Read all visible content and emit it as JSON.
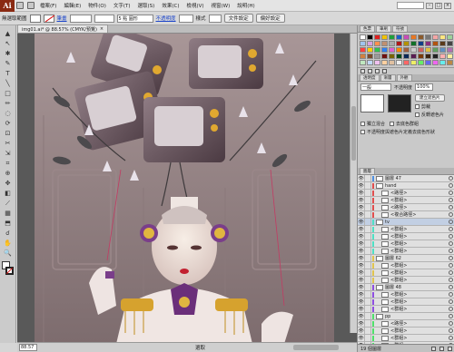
{
  "app": {
    "logo": "Ai",
    "workspace": "無違取範圍",
    "menus": [
      "檔案(F)",
      "編輯(E)",
      "物件(O)",
      "文字(T)",
      "選取(S)",
      "效果(C)",
      "檢視(V)",
      "視窗(W)",
      "說明(H)"
    ]
  },
  "controlbar": {
    "selection_label": "無選取範圍",
    "stroke_label": "筆畫",
    "stroke_weight": "",
    "brush_value": "5 點 圓形",
    "opacity_link": "不透明度",
    "style_label": "樣式",
    "doc_setup_button": "文件設定",
    "preferences_button": "偏好設定"
  },
  "tools": [
    "▲",
    "↖",
    "✱",
    "✎",
    "T",
    "╲",
    "□",
    "✏",
    "◌",
    "⟳",
    "⊡",
    "✂",
    "⇲",
    "⌗",
    "⊕",
    "✥",
    "◧",
    "⟋",
    "▦",
    "⬒",
    "☌",
    "✋",
    "🔍"
  ],
  "document": {
    "tab_title": "img01.ai* @ 88.57% (CMYK/預覽)",
    "tab_close": "×",
    "zoom": "88.57",
    "status": "選取"
  },
  "panels": {
    "swatch_tabs": [
      "色票",
      "筆刷",
      "符號"
    ],
    "swatch_colors": [
      "#ffffff",
      "#000000",
      "#e02020",
      "#f2c200",
      "#1ea03a",
      "#1a5fc8",
      "#c84bb8",
      "#e87722",
      "#8b5a2b",
      "#777777",
      "#f4a6a6",
      "#ffe680",
      "#9dd39a",
      "#a0c4f0",
      "#d9a0e0",
      "#ff9050",
      "#c09070",
      "#aaaaaa",
      "#b01818",
      "#b39200",
      "#117028",
      "#103e88",
      "#8a2e7d",
      "#b25410",
      "#5a3a1a",
      "#444444",
      "#ff4040",
      "#ffd000",
      "#30c050",
      "#3080f0",
      "#e060d0",
      "#ff8800",
      "#a06040",
      "#cccccc",
      "#d06060",
      "#e0c040",
      "#60a060",
      "#6090c0",
      "#b070b0",
      "#d08040",
      "#7a4a2a",
      "#999999",
      "#701010",
      "#7a6400",
      "#0a4a18",
      "#0a2858",
      "#5a1c52",
      "#7a3a08",
      "#3a2410",
      "#222222",
      "#ffb0b0",
      "#fff0a0",
      "#c0e8c0",
      "#c0d8f8",
      "#f0c0f0",
      "#ffd0a0",
      "#e0c0a0",
      "#eeeeee",
      "#ff6666",
      "#eeee66",
      "#66ee66",
      "#6666ee",
      "#ee66ee",
      "#66eeee",
      "#bb8844"
    ],
    "transparency_tab": "透明度",
    "gradient_tab": "漸層",
    "appearance_tab": "外觀",
    "blend_mode": "一般",
    "opacity_label": "不透明度",
    "opacity_value": "100%",
    "make_mask_label": "建立遮色片",
    "clip_label": "剪裁",
    "invert_label": "反轉遮色片",
    "isolate_label": "獨立混合",
    "knockout_label": "去底色群組",
    "opacity_mask_label": "不透明度與遮色片定義去底色形狀",
    "layers_tab": "圖層",
    "layers": [
      {
        "name": "圖層 47",
        "color": "#4e8fe0",
        "selected": false
      },
      {
        "name": "hand",
        "color": "#e04e4e",
        "selected": false
      },
      {
        "name": "<路徑>",
        "color": "#e04e4e",
        "selected": false
      },
      {
        "name": "<群組>",
        "color": "#e04e4e",
        "selected": false
      },
      {
        "name": "<路徑>",
        "color": "#e04e4e",
        "selected": false
      },
      {
        "name": "<複合路徑>",
        "color": "#e04e4e",
        "selected": false
      },
      {
        "name": "tv",
        "color": "#4ee0c4",
        "selected": true
      },
      {
        "name": "<群組>",
        "color": "#4ee0c4",
        "selected": false
      },
      {
        "name": "<群組>",
        "color": "#4ee0c4",
        "selected": false
      },
      {
        "name": "<群組>",
        "color": "#4ee0c4",
        "selected": false
      },
      {
        "name": "<群組>",
        "color": "#4ee0c4",
        "selected": false
      },
      {
        "name": "圖層 62",
        "color": "#e0c44e",
        "selected": false
      },
      {
        "name": "<群組>",
        "color": "#e0c44e",
        "selected": false
      },
      {
        "name": "<群組>",
        "color": "#e0c44e",
        "selected": false
      },
      {
        "name": "<群組>",
        "color": "#e0c44e",
        "selected": false
      },
      {
        "name": "圖層 48",
        "color": "#8e4ee0",
        "selected": false
      },
      {
        "name": "<群組>",
        "color": "#8e4ee0",
        "selected": false
      },
      {
        "name": "<群組>",
        "color": "#8e4ee0",
        "selected": false
      },
      {
        "name": "<群組>",
        "color": "#8e4ee0",
        "selected": false
      },
      {
        "name": "pp",
        "color": "#4ee06a",
        "selected": false
      },
      {
        "name": "<路徑>",
        "color": "#4ee06a",
        "selected": false
      },
      {
        "name": "<群組>",
        "color": "#4ee06a",
        "selected": false
      },
      {
        "name": "<群組>",
        "color": "#4ee06a",
        "selected": false
      },
      {
        "name": "<群組>",
        "color": "#4ee06a",
        "selected": false
      }
    ],
    "layers_count": "19 個圖層"
  }
}
